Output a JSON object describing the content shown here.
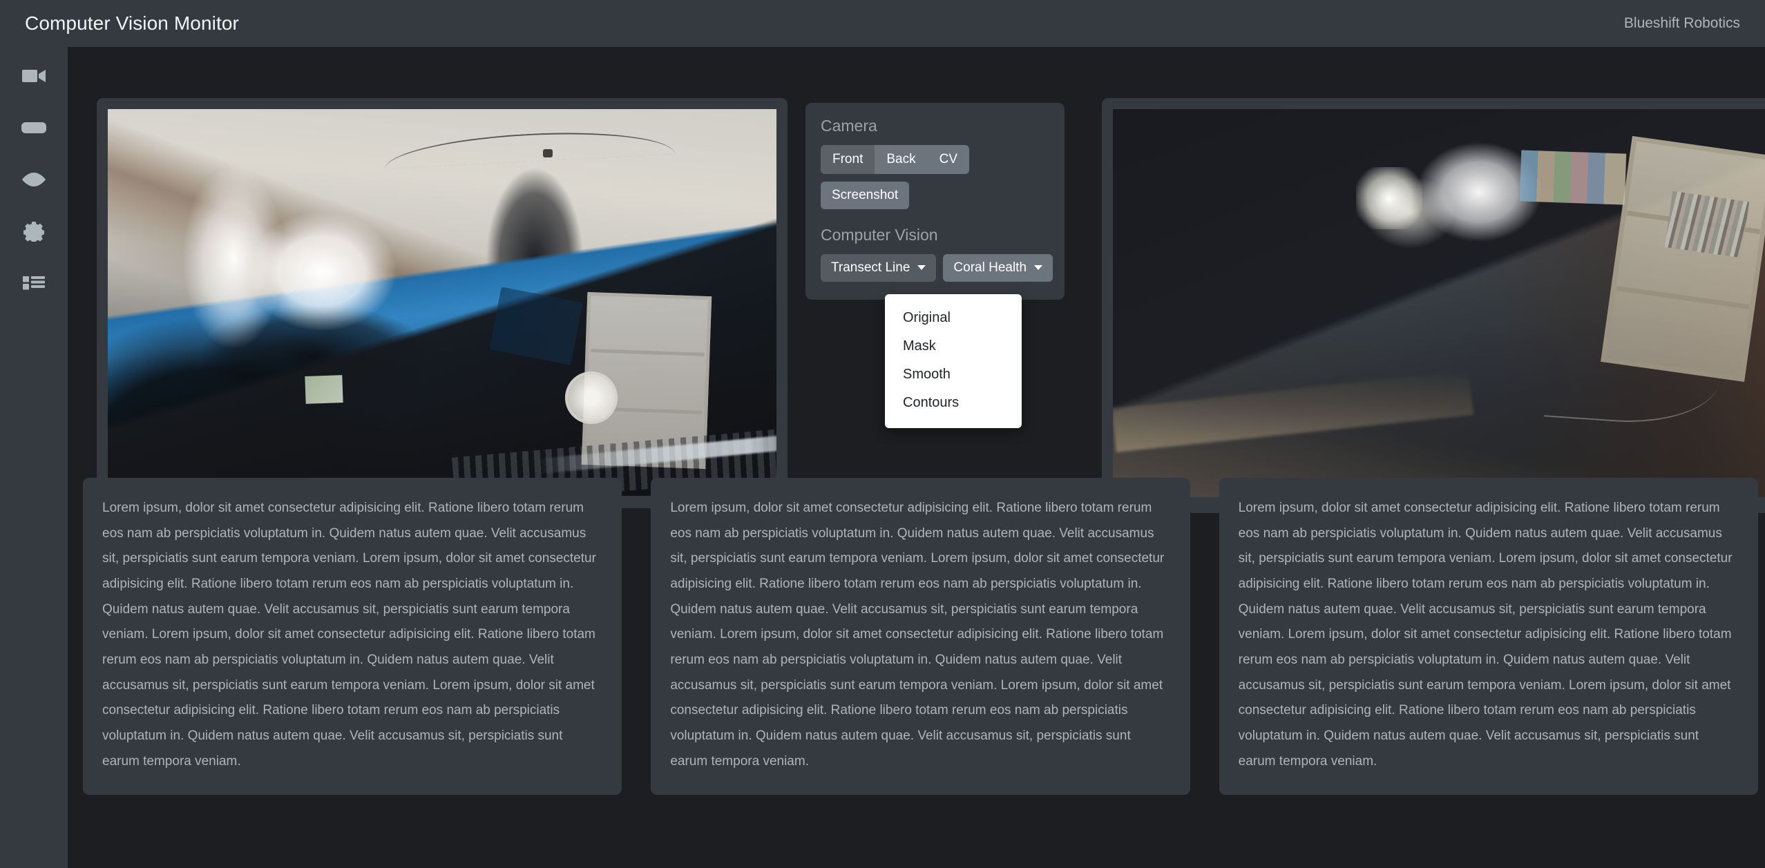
{
  "header": {
    "title": "Computer Vision Monitor",
    "brand": "Blueshift Robotics",
    "background": "#343a40"
  },
  "sidebar": {
    "background": "#343a40",
    "icon_color": "#adb5bd",
    "items": [
      {
        "name": "video-camera-icon",
        "label": "Video"
      },
      {
        "name": "gamepad-icon",
        "label": "Controls"
      },
      {
        "name": "eye-icon",
        "label": "Vision"
      },
      {
        "name": "gear-icon",
        "label": "Settings"
      },
      {
        "name": "list-icon",
        "label": "Logs"
      }
    ]
  },
  "controls": {
    "camera_heading": "Camera",
    "camera_buttons": [
      {
        "label": "Front",
        "active": true
      },
      {
        "label": "Back",
        "active": false
      },
      {
        "label": "CV",
        "active": false
      }
    ],
    "screenshot_label": "Screenshot",
    "cv_heading": "Computer Vision",
    "dropdowns": [
      {
        "label": "Transect Line",
        "open": true
      },
      {
        "label": "Coral Health",
        "open": false
      }
    ],
    "button_color": "#6c757d",
    "button_active_color": "#5a6268"
  },
  "dropdown_menu": {
    "open_for": "Transect Line",
    "background": "#ffffff",
    "items": [
      {
        "label": "Original"
      },
      {
        "label": "Mask"
      },
      {
        "label": "Smooth"
      },
      {
        "label": "Contours"
      }
    ]
  },
  "feeds": [
    {
      "name": "front-camera-feed",
      "description": "Webcam view of a room interior with bright window light, blue banner, bookshelf and monitor"
    },
    {
      "name": "cv-camera-feed",
      "description": "Dim webcam view of a room with laptop lid, bookshelf, photos and desk"
    }
  ],
  "cards": [
    {
      "text": "Lorem ipsum, dolor sit amet consectetur adipisicing elit. Ratione libero totam rerum eos nam ab perspiciatis voluptatum in. Quidem natus autem quae. Velit accusamus sit, perspiciatis sunt earum tempora veniam. Lorem ipsum, dolor sit amet consectetur adipisicing elit. Ratione libero totam rerum eos nam ab perspiciatis voluptatum in. Quidem natus autem quae. Velit accusamus sit, perspiciatis sunt earum tempora veniam. Lorem ipsum, dolor sit amet consectetur adipisicing elit. Ratione libero totam rerum eos nam ab perspiciatis voluptatum in. Quidem natus autem quae. Velit accusamus sit, perspiciatis sunt earum tempora veniam. Lorem ipsum, dolor sit amet consectetur adipisicing elit. Ratione libero totam rerum eos nam ab perspiciatis voluptatum in. Quidem natus autem quae. Velit accusamus sit, perspiciatis sunt earum tempora veniam."
    },
    {
      "text": "Lorem ipsum, dolor sit amet consectetur adipisicing elit. Ratione libero totam rerum eos nam ab perspiciatis voluptatum in. Quidem natus autem quae. Velit accusamus sit, perspiciatis sunt earum tempora veniam. Lorem ipsum, dolor sit amet consectetur adipisicing elit. Ratione libero totam rerum eos nam ab perspiciatis voluptatum in. Quidem natus autem quae. Velit accusamus sit, perspiciatis sunt earum tempora veniam. Lorem ipsum, dolor sit amet consectetur adipisicing elit. Ratione libero totam rerum eos nam ab perspiciatis voluptatum in. Quidem natus autem quae. Velit accusamus sit, perspiciatis sunt earum tempora veniam. Lorem ipsum, dolor sit amet consectetur adipisicing elit. Ratione libero totam rerum eos nam ab perspiciatis voluptatum in. Quidem natus autem quae. Velit accusamus sit, perspiciatis sunt earum tempora veniam."
    },
    {
      "text": "Lorem ipsum, dolor sit amet consectetur adipisicing elit. Ratione libero totam rerum eos nam ab perspiciatis voluptatum in. Quidem natus autem quae. Velit accusamus sit, perspiciatis sunt earum tempora veniam. Lorem ipsum, dolor sit amet consectetur adipisicing elit. Ratione libero totam rerum eos nam ab perspiciatis voluptatum in. Quidem natus autem quae. Velit accusamus sit, perspiciatis sunt earum tempora veniam. Lorem ipsum, dolor sit amet consectetur adipisicing elit. Ratione libero totam rerum eos nam ab perspiciatis voluptatum in. Quidem natus autem quae. Velit accusamus sit, perspiciatis sunt earum tempora veniam. Lorem ipsum, dolor sit amet consectetur adipisicing elit. Ratione libero totam rerum eos nam ab perspiciatis voluptatum in. Quidem natus autem quae. Velit accusamus sit, perspiciatis sunt earum tempora veniam."
    }
  ],
  "theme": {
    "page_background": "#1c1e21",
    "panel_background": "#343a40",
    "muted_text": "#9aa2aa",
    "body_text": "#aeb4ba"
  }
}
